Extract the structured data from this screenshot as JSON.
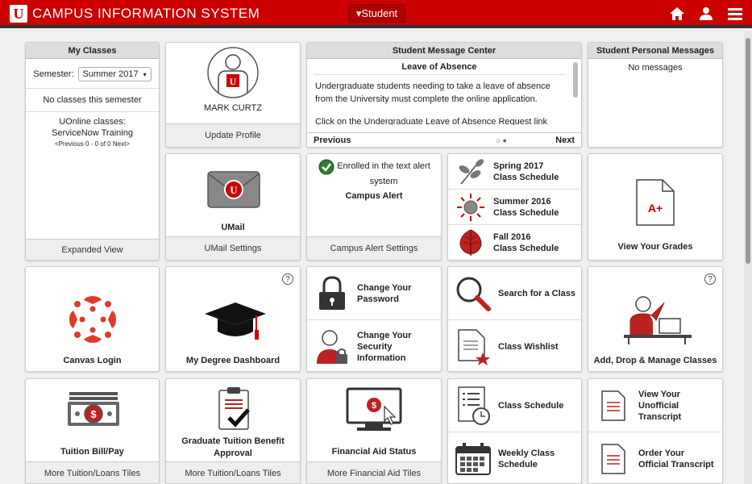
{
  "header": {
    "logo": "U",
    "title": "CAMPUS INFORMATION SYSTEM",
    "role": "▾Student"
  },
  "my_classes": {
    "title": "My Classes",
    "semester_label": "Semester:",
    "semester_value": "Summer 2017",
    "no_classes": "No classes this semester",
    "uonline_label": "UOnline classes:",
    "uonline_course": "ServiceNow Training",
    "pager": "<Previous 0 - 0 of 0 Next>",
    "footer": "Expanded View"
  },
  "profile": {
    "name": "MARK CURTZ",
    "footer": "Update Profile",
    "shirt_letter": "U"
  },
  "message_center": {
    "title": "Student Message Center",
    "msg_title": "Leave of Absence",
    "msg_body1": "Undergraduate students needing to take a leave of absence from the University must complete the online application.",
    "msg_body2": "Click on the Undergraduate Leave of Absence Request link",
    "prev": "Previous",
    "next": "Next",
    "dots": "○ ●"
  },
  "personal_messages": {
    "title": "Student Personal Messages",
    "body": "No messages"
  },
  "umail": {
    "label": "UMail",
    "footer": "UMail Settings",
    "badge": "U"
  },
  "campus_alert": {
    "enrolled": "Enrolled in the text alert system",
    "label": "Campus Alert",
    "footer": "Campus Alert Settings"
  },
  "schedules": [
    {
      "label_line1": "Spring 2017",
      "label_line2": "Class Schedule"
    },
    {
      "label_line1": "Summer 2016",
      "label_line2": "Class Schedule"
    },
    {
      "label_line1": "Fall 2016",
      "label_line2": "Class Schedule"
    }
  ],
  "grades": {
    "label": "View Your Grades",
    "grade": "A+"
  },
  "canvas": {
    "label": "Canvas Login"
  },
  "degree": {
    "label": "My Degree Dashboard",
    "help": "?"
  },
  "password": {
    "label_line1": "Change Your",
    "label_line2": "Password"
  },
  "security": {
    "label_line1": "Change Your",
    "label_line2": "Security",
    "label_line3": "Information"
  },
  "search_class": {
    "label": "Search for a Class"
  },
  "wishlist": {
    "label": "Class Wishlist"
  },
  "add_drop": {
    "label": "Add, Drop & Manage Classes",
    "help": "?"
  },
  "tuition": {
    "label": "Tuition Bill/Pay",
    "footer": "More Tuition/Loans Tiles",
    "symbol": "$"
  },
  "grad_tuition": {
    "label_line1": "Graduate Tuition Benefit",
    "label_line2": "Approval",
    "footer": "More Tuition/Loans Tiles"
  },
  "financial_aid": {
    "label": "Financial Aid Status",
    "footer": "More Financial Aid Tiles",
    "symbol": "$"
  },
  "class_schedule": {
    "label": "Class Schedule"
  },
  "weekly": {
    "label_line1": "Weekly Class",
    "label_line2": "Schedule"
  },
  "transcript": {
    "label_line1": "View Your",
    "label_line2": "Unofficial",
    "label_line3": "Transcript"
  },
  "order_transcript": {
    "label_line1": "Order Your",
    "label_line2": "Official Transcript"
  },
  "colors": {
    "brand": "#cc0000",
    "header_bar": "#333333",
    "tile_header": "#dddddd"
  }
}
